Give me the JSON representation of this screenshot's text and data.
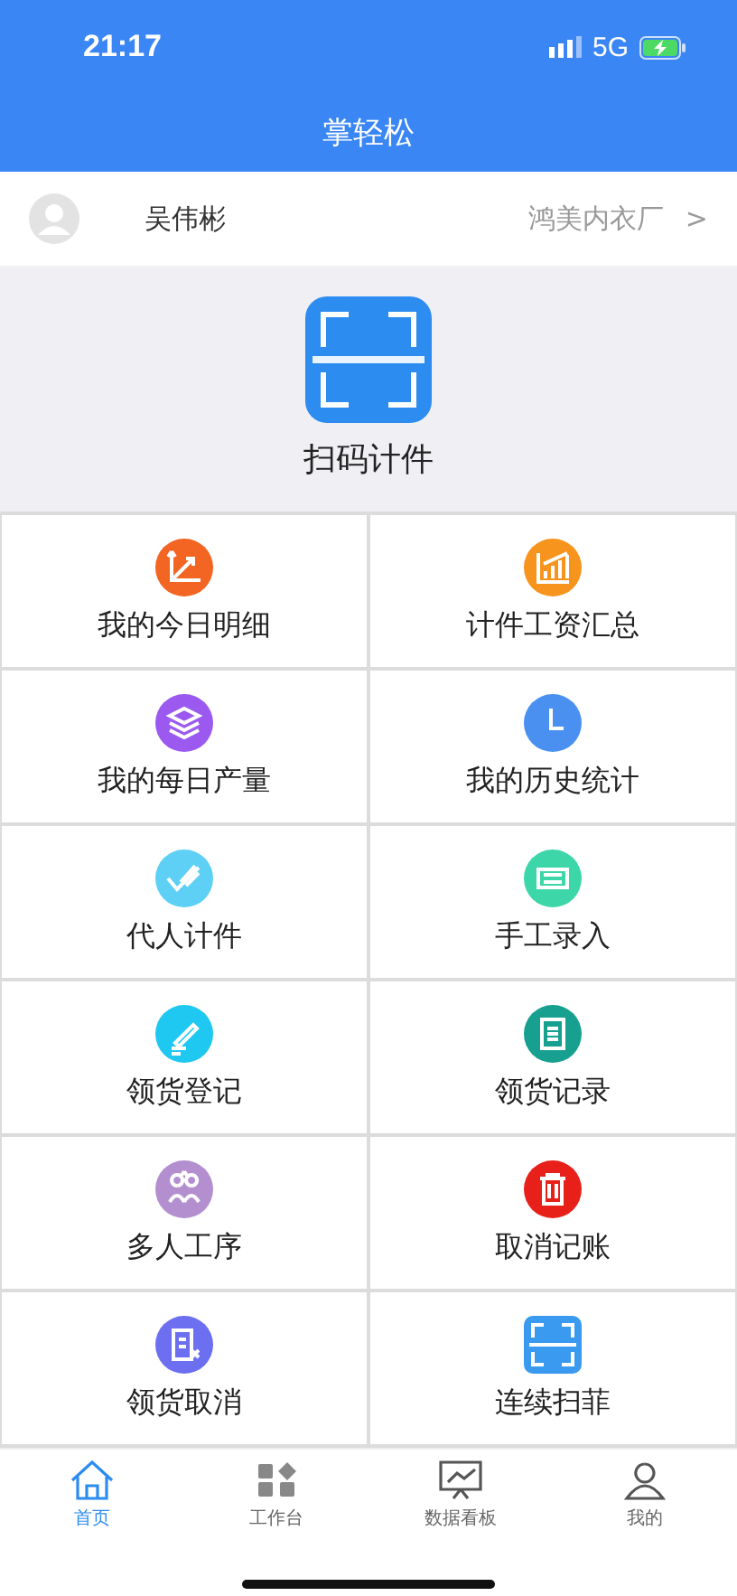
{
  "status_bar": {
    "time": "21:17",
    "network": "5G"
  },
  "header": {
    "title": "掌轻松"
  },
  "user": {
    "name": "吴伟彬",
    "company": "鸿美内衣厂",
    "chevron": ">"
  },
  "scan": {
    "label": "扫码计件"
  },
  "tiles": [
    {
      "label": "我的今日明细",
      "kind": "trend",
      "color": "#f26522"
    },
    {
      "label": "计件工资汇总",
      "kind": "bars",
      "color": "#f7941d"
    },
    {
      "label": "我的每日产量",
      "kind": "layers",
      "color": "#9b59f0"
    },
    {
      "label": "我的历史统计",
      "kind": "clock",
      "color": "#4a90f0"
    },
    {
      "label": "代人计件",
      "kind": "hand",
      "color": "#5ed0f5"
    },
    {
      "label": "手工录入",
      "kind": "keyboard",
      "color": "#3dd6a8"
    },
    {
      "label": "领货登记",
      "kind": "pen",
      "color": "#1ec8f0"
    },
    {
      "label": "领货记录",
      "kind": "document",
      "color": "#17a090"
    },
    {
      "label": "多人工序",
      "kind": "people",
      "color": "#b48fd0"
    },
    {
      "label": "取消记账",
      "kind": "trash",
      "color": "#e8201a"
    },
    {
      "label": "领货取消",
      "kind": "doc-cancel",
      "color": "#6b6ff0"
    },
    {
      "label": "连续扫菲",
      "kind": "scan",
      "color": "#3a9af0"
    }
  ],
  "tabs": [
    {
      "label": "首页",
      "kind": "home",
      "selected": true
    },
    {
      "label": "工作台",
      "kind": "grid",
      "selected": false
    },
    {
      "label": "数据看板",
      "kind": "board",
      "selected": false
    },
    {
      "label": "我的",
      "kind": "person",
      "selected": false
    }
  ]
}
